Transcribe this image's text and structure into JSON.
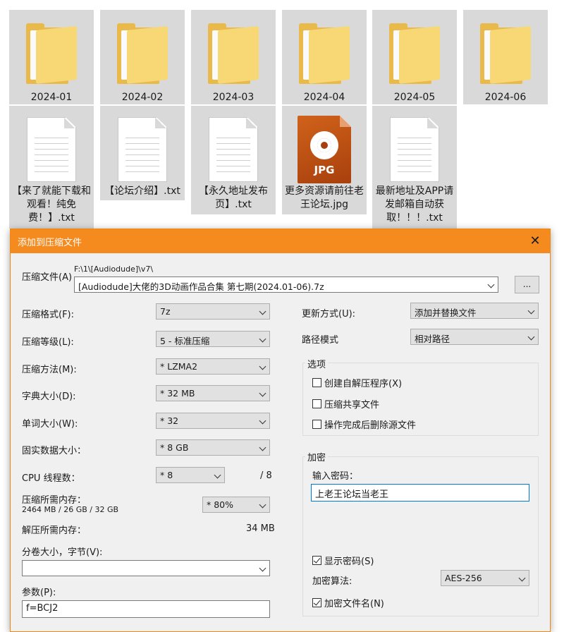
{
  "folders": [
    {
      "name": "2024-01"
    },
    {
      "name": "2024-02"
    },
    {
      "name": "2024-03"
    },
    {
      "name": "2024-04"
    },
    {
      "name": "2024-05"
    },
    {
      "name": "2024-06"
    }
  ],
  "files": [
    {
      "name": "【来了就能下载和观看！纯免费！】.txt",
      "type": "txt-icon"
    },
    {
      "name": "【论坛介绍】.txt",
      "type": "txt-icon"
    },
    {
      "name": "【永久地址发布页】.txt",
      "type": "txt-icon"
    },
    {
      "name": "更多资源请前往老王论坛.jpg",
      "type": "jpg-icon",
      "badge": "JPG"
    },
    {
      "name": "最新地址及APP请发邮箱自动获取！！！.txt",
      "type": "txt-icon"
    }
  ],
  "dialog": {
    "title": "添加到压缩文件",
    "close_icon": "✕",
    "archive_label": "压缩文件(A)",
    "archive_path": "F:\\1\\[Audiodude]\\v7\\",
    "archive_name": "[Audiodude]大佬的3D动画作品合集 第七期(2024.01-06).7z",
    "browse_label": "...",
    "format_label": "压缩格式(F):",
    "format_value": "7z",
    "level_label": "压缩等级(L):",
    "level_value": "5 - 标准压缩",
    "method_label": "压缩方法(M):",
    "method_value": "* LZMA2",
    "dict_label": "字典大小(D):",
    "dict_value": "* 32 MB",
    "word_label": "单词大小(W):",
    "word_value": "* 32",
    "solid_label": "固实数据大小：",
    "solid_value": "* 8 GB",
    "threads_label": "CPU 线程数：",
    "threads_value": "* 8",
    "threads_max": "/ 8",
    "mem_label": "压缩所需内存：",
    "mem_detail": "2464 MB / 26 GB / 32 GB",
    "mem_value": "* 80%",
    "decomp_label": "解压所需内存：",
    "decomp_value": "34 MB",
    "volume_label": "分卷大小，字节(V):",
    "volume_value": "",
    "params_label": "参数(P):",
    "params_value": "f=BCJ2",
    "update_label": "更新方式(U):",
    "update_value": "添加并替换文件",
    "path_label": "路径模式",
    "path_value": "相对路径",
    "options_title": "选项",
    "opt_sfx": "创建自解压程序(X)",
    "opt_shared": "压缩共享文件",
    "opt_delete": "操作完成后删除源文件",
    "encrypt_title": "加密",
    "password_label": "输入密码：",
    "password_value": "上老王论坛当老王",
    "show_password": "显示密码(S)",
    "algo_label": "加密算法:",
    "algo_value": "AES-256",
    "encrypt_names": "加密文件名(N)"
  }
}
